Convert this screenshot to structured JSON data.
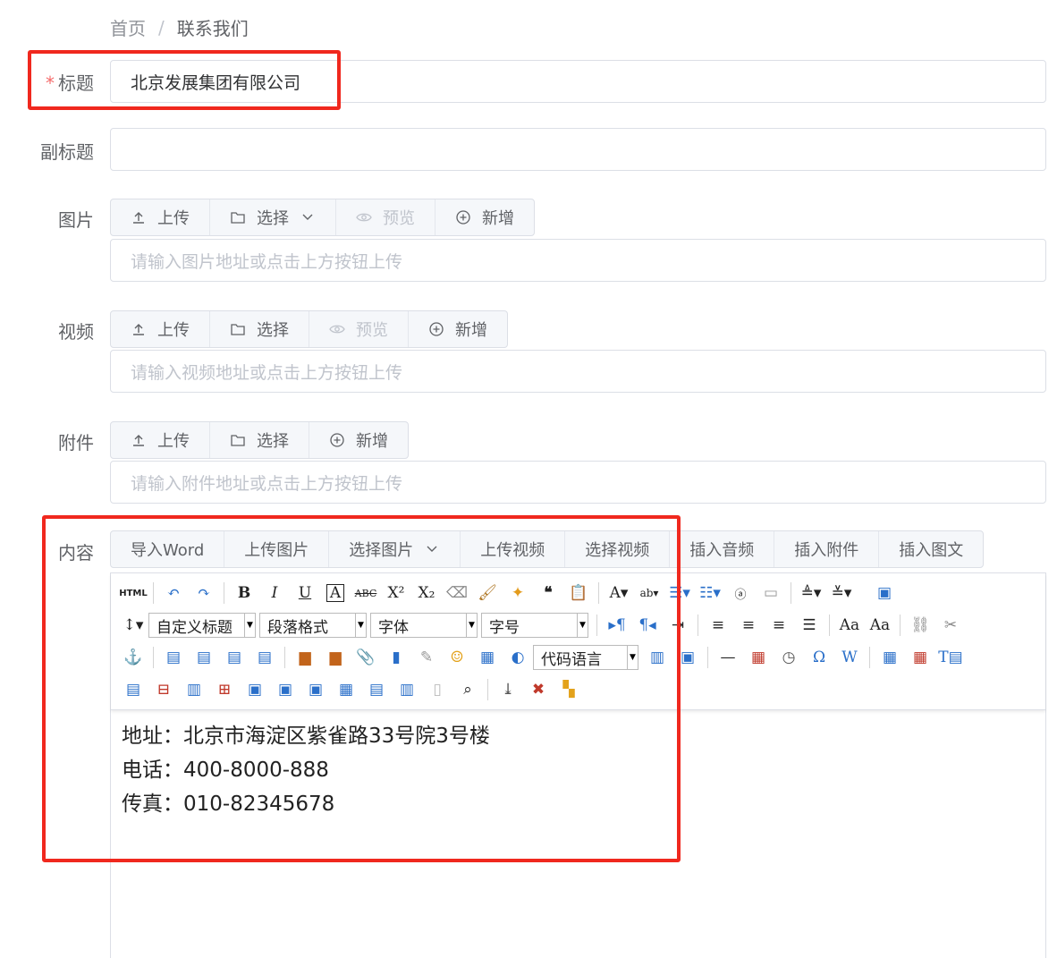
{
  "breadcrumb": {
    "home": "首页",
    "separator": "/",
    "current": "联系我们"
  },
  "fields": {
    "title": {
      "label": "标题",
      "required_mark": "*",
      "value": "北京发展集团有限公司"
    },
    "subtitle": {
      "label": "副标题",
      "value": ""
    },
    "image": {
      "label": "图片",
      "upload": "上传",
      "select": "选择",
      "preview": "预览",
      "add": "新增",
      "placeholder": "请输入图片地址或点击上方按钮上传"
    },
    "video": {
      "label": "视频",
      "upload": "上传",
      "select": "选择",
      "preview": "预览",
      "add": "新增",
      "placeholder": "请输入视频地址或点击上方按钮上传"
    },
    "attachment": {
      "label": "附件",
      "upload": "上传",
      "select": "选择",
      "add": "新增",
      "placeholder": "请输入附件地址或点击上方按钮上传"
    },
    "content": {
      "label": "内容",
      "actions": [
        "导入Word",
        "上传图片",
        "选择图片",
        "上传视频",
        "选择视频",
        "插入音频",
        "插入附件",
        "插入图文"
      ],
      "combos": {
        "custom_heading": "自定义标题",
        "paragraph": "段落格式",
        "font": "字体",
        "size": "字号",
        "code_lang": "代码语言"
      },
      "lines": [
        "地址：北京市海淀区紫雀路33号院3号楼",
        "电话：400-8000-888",
        "传真：010-82345678"
      ]
    }
  },
  "colors": {
    "highlight_box": "#f0281e",
    "required": "#f56c6c",
    "border": "#dcdfe6"
  }
}
